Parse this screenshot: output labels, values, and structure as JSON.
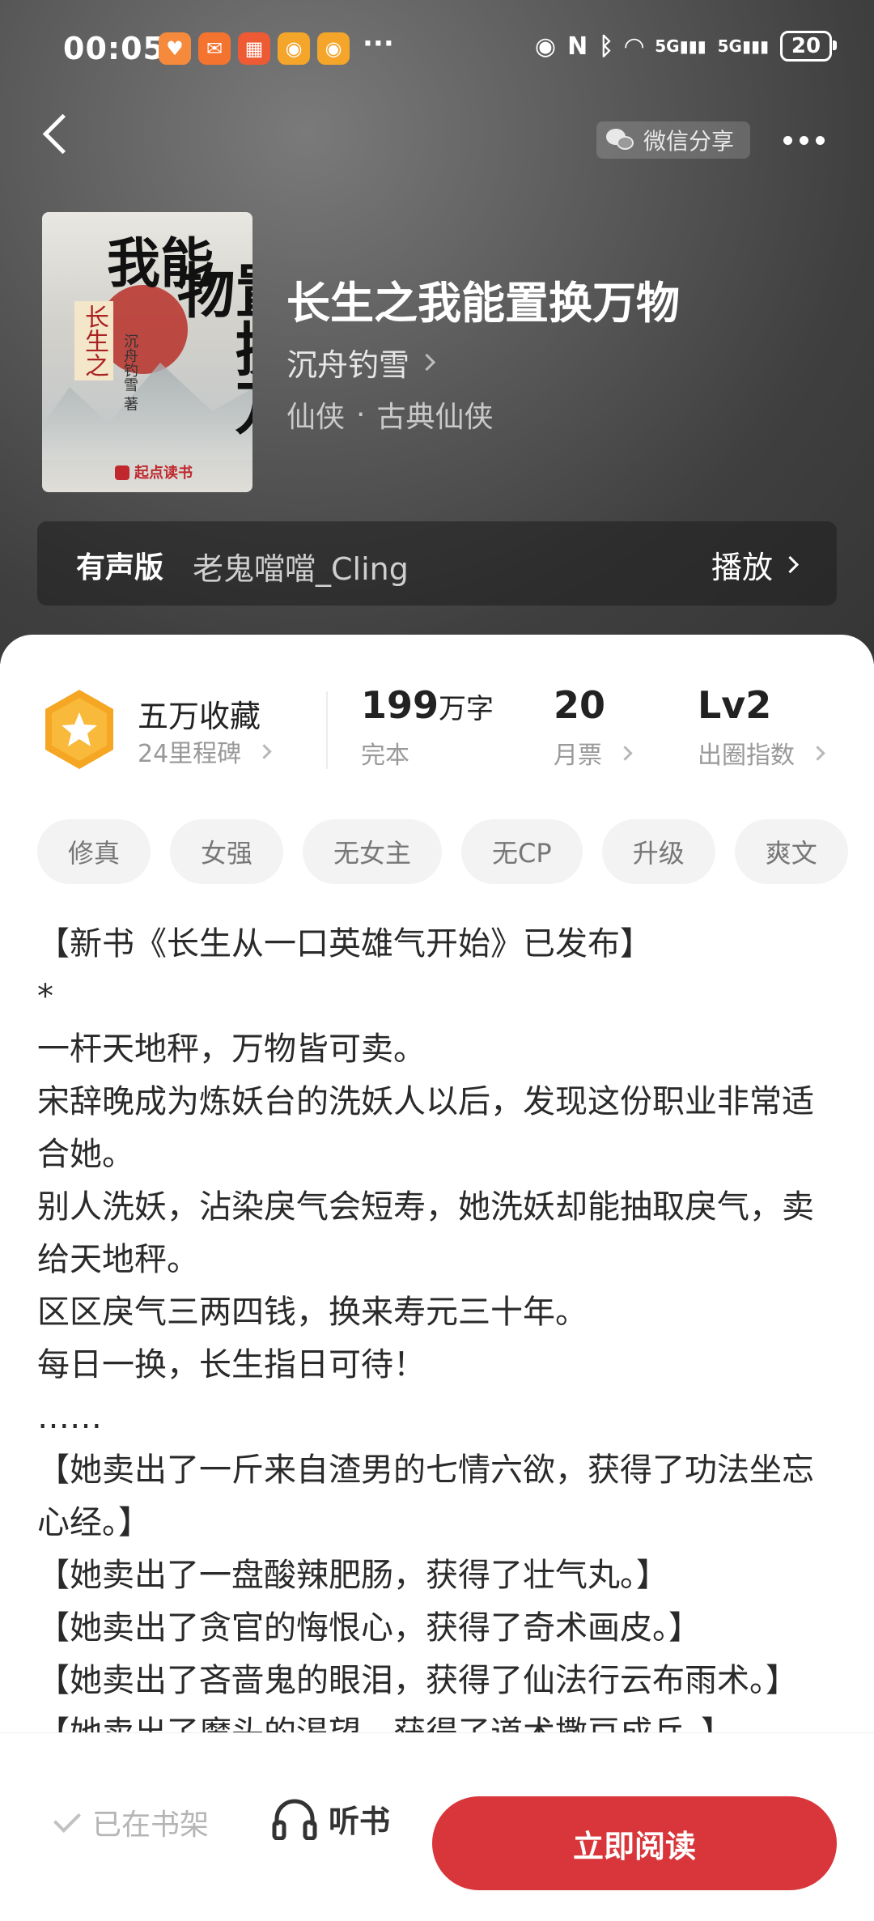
{
  "status_bar": {
    "time": "00:05",
    "more": "···",
    "signal1": "5G",
    "signal2": "5G",
    "battery": "20",
    "app_icons": [
      {
        "name": "shield-app-icon",
        "color": "#f58a3c"
      },
      {
        "name": "mail-app-icon",
        "color": "#f4732f"
      },
      {
        "name": "grid-app-icon",
        "color": "#ee5a34"
      },
      {
        "name": "weibo-app-icon",
        "color": "#f4a52a"
      },
      {
        "name": "weibo2-app-icon",
        "color": "#f4a52a"
      }
    ]
  },
  "nav": {
    "share_label": "微信分享"
  },
  "book": {
    "title": "长生之我能置换万物",
    "author": "沉舟钓雪",
    "category": "仙侠",
    "subcategory": "古典仙侠",
    "category_separator": "·",
    "cover": {
      "title_main_a": "我能",
      "title_main_b": "置换万物",
      "title_prefix": "长生之",
      "cover_author": "沉舟钓雪 著",
      "publisher": "起点读书"
    }
  },
  "audio": {
    "label": "有声版",
    "narrator": "老鬼噹噹_Cling",
    "play_label": "播放"
  },
  "stats": {
    "favorites": "五万收藏",
    "milestones": "24里程碑",
    "word_count": "199",
    "word_unit": "万字",
    "completion": "完本",
    "monthly_tickets": "20",
    "monthly_label": "月票",
    "level": "Lv2",
    "level_label": "出圈指数"
  },
  "tags": [
    "修真",
    "女强",
    "无女主",
    "无CP",
    "升级",
    "爽文"
  ],
  "description": [
    "【新书《长生从一口英雄气开始》已发布】",
    "*",
    "一杆天地秤，万物皆可卖。",
    "宋辞晚成为炼妖台的洗妖人以后，发现这份职业非常适合她。",
    "别人洗妖，沾染戾气会短寿，她洗妖却能抽取戾气，卖给天地秤。",
    "区区戾气三两四钱，换来寿元三十年。",
    "每日一换，长生指日可待！",
    "……",
    "【她卖出了一斤来自渣男的七情六欲，获得了功法坐忘心经。】",
    "【她卖出了一盘酸辣肥肠，获得了壮气丸。】",
    "【她卖出了贪官的悔恨心，获得了奇术画皮。】",
    "【她卖出了吝啬鬼的眼泪，获得了仙法行云布雨术。】",
    "【她卖出了魔头的渴望，获得了道术撒豆成兵。】"
  ],
  "bottom_bar": {
    "shelf_label": "已在书架",
    "listen_label": "听书",
    "read_label": "立即阅读"
  },
  "colors": {
    "accent_red": "#d8363b",
    "medal_orange": "#f5a623"
  }
}
